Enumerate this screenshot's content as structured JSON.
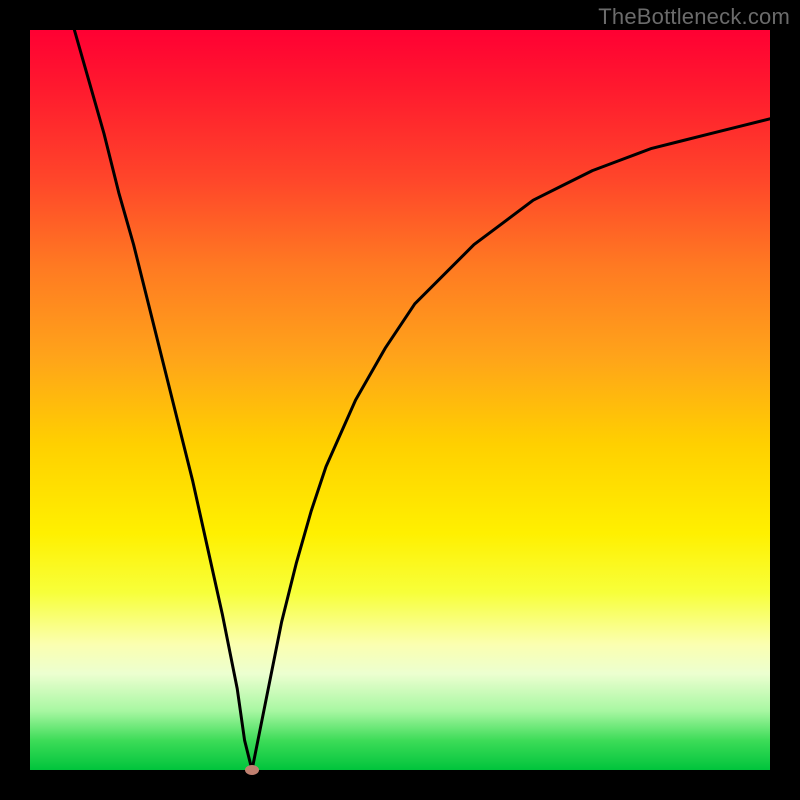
{
  "watermark": "TheBottleneck.com",
  "chart_data": {
    "type": "line",
    "title": "",
    "xlabel": "",
    "ylabel": "",
    "xlim": [
      0,
      100
    ],
    "ylim": [
      0,
      100
    ],
    "grid": false,
    "legend": false,
    "series": [
      {
        "name": "bottleneck-curve",
        "x": [
          6,
          8,
          10,
          12,
          14,
          16,
          18,
          20,
          22,
          24,
          26,
          28,
          29,
          30,
          32,
          34,
          36,
          38,
          40,
          44,
          48,
          52,
          56,
          60,
          64,
          68,
          72,
          76,
          80,
          84,
          88,
          92,
          96,
          100
        ],
        "y": [
          100,
          93,
          86,
          78,
          71,
          63,
          55,
          47,
          39,
          30,
          21,
          11,
          4,
          0,
          10,
          20,
          28,
          35,
          41,
          50,
          57,
          63,
          67,
          71,
          74,
          77,
          79,
          81,
          82.5,
          84,
          85,
          86,
          87,
          88
        ]
      }
    ],
    "marker": {
      "x": 30,
      "y": 0,
      "name": "optimal-point"
    },
    "background_gradient": {
      "top": "#ff0033",
      "bottom": "#00c43c",
      "stops": [
        "red",
        "orange",
        "yellow",
        "green"
      ]
    }
  }
}
